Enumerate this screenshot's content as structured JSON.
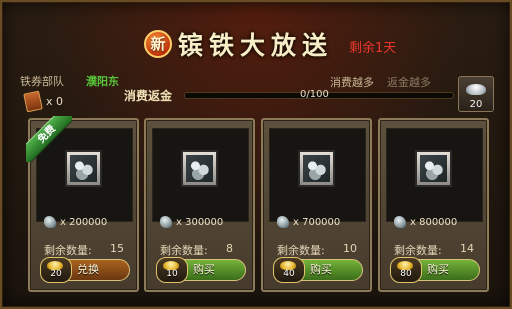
{
  "header": {
    "new_badge": "新",
    "title": "镔铁大放送",
    "remaining": "剩余1天"
  },
  "info": {
    "team_label": "铁券部队",
    "team_name": "濮阳东",
    "coupon_count": "x 0",
    "spend_more": "消费越多",
    "return_more": "返金越多",
    "rebate_label": "消费返金",
    "progress_text": "0/100",
    "progress_fraction": 0,
    "silver_count": "20"
  },
  "cards": [
    {
      "free_tag": "免费",
      "cost": "x 200000",
      "remain_label": "剩余数量:",
      "remain_value": "15",
      "price": "20",
      "button": "兑换"
    },
    {
      "cost": "x 300000",
      "remain_label": "剩余数量:",
      "remain_value": "8",
      "price": "10",
      "button": "购买"
    },
    {
      "cost": "x 700000",
      "remain_label": "剩余数量:",
      "remain_value": "10",
      "price": "40",
      "button": "购买"
    },
    {
      "cost": "x 800000",
      "remain_label": "剩余数量:",
      "remain_value": "14",
      "price": "80",
      "button": "购买"
    }
  ],
  "colors": {
    "accent_red": "#e8352c",
    "team_green": "#57c43a",
    "buy_green": "#74b33a",
    "exchange_orange": "#a9621f"
  }
}
